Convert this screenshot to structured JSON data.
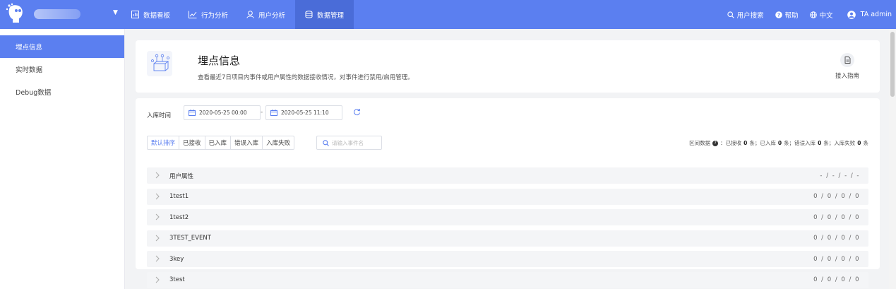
{
  "topbar": {
    "caret_icon": "caret-down-icon",
    "nav": [
      {
        "label": "数据看板",
        "icon": "dashboard-icon"
      },
      {
        "label": "行为分析",
        "icon": "trend-icon"
      },
      {
        "label": "用户分析",
        "icon": "user-icon"
      },
      {
        "label": "数据管理",
        "icon": "database-icon",
        "active": true
      }
    ],
    "right": {
      "user_search": "用户搜索",
      "help": "帮助",
      "lang": "中文",
      "user": "TA admin"
    }
  },
  "sidebar": {
    "items": [
      {
        "label": "埋点信息",
        "active": true
      },
      {
        "label": "实时数据"
      },
      {
        "label": "Debug数据"
      }
    ]
  },
  "header": {
    "title": "埋点信息",
    "description": "查看最近7日项目内事件或用户属性的数据接收情况，对事件进行禁用/启用管理。",
    "guide_label": "接入指南"
  },
  "filter": {
    "time_label": "入库时间",
    "date_start": "2020-05-25 00:00",
    "date_sep": "-",
    "date_end": "2020-05-25 11:10",
    "sort_tabs": [
      "默认排序",
      "已接收",
      "已入库",
      "错误入库",
      "入库失败"
    ],
    "search_placeholder": "请输入事件名",
    "stats": {
      "prefix": "区间数据",
      "received_label": "：已接收",
      "received": "0",
      "stored_label": "条；已入库",
      "stored": "0",
      "error_label": "条；错误入库",
      "error": "0",
      "failed_label": "条；入库失败",
      "failed": "0",
      "suffix": "条"
    }
  },
  "events": [
    {
      "name": "用户属性",
      "stats": "- / - / - / -"
    },
    {
      "name": "1test1",
      "stats": "0 / 0 / 0 / 0"
    },
    {
      "name": "1test2",
      "stats": "0 / 0 / 0 / 0"
    },
    {
      "name": "3TEST_EVENT",
      "stats": "0 / 0 / 0 / 0"
    },
    {
      "name": "3key",
      "stats": "0 / 0 / 0 / 0"
    },
    {
      "name": "3test",
      "stats": "0 / 0 / 0 / 0"
    }
  ],
  "colors": {
    "primary": "#5b7ff0",
    "nav_active": "#4a6cd8"
  }
}
